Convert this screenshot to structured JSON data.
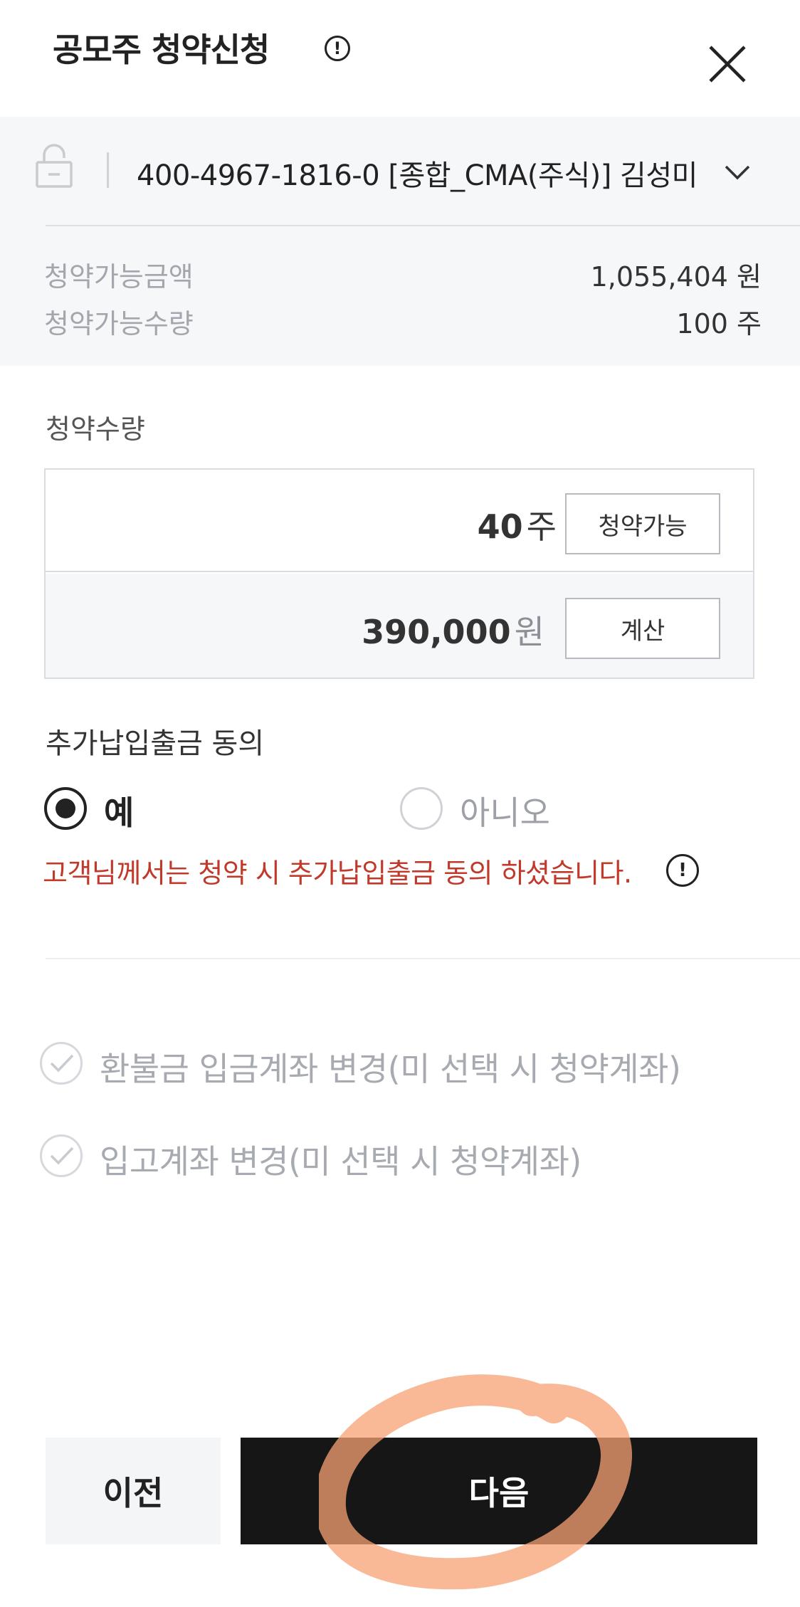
{
  "header": {
    "title": "공모주 청약신청",
    "info_glyph": "!",
    "icons": {
      "info": "info-circle-icon",
      "close": "close-icon"
    }
  },
  "account": {
    "number": "400-4967-1816-0  [종합_CMA(주식)] 김성미",
    "icons": {
      "lock": "lock-icon",
      "chevron": "chevron-down-icon"
    },
    "available_amount_label": "청약가능금액",
    "available_amount_value": "1,055,404 원",
    "available_qty_label": "청약가능수량",
    "available_qty_value": "100 주"
  },
  "quantity": {
    "label": "청약수량",
    "value": "40",
    "unit": "주",
    "max_button": "청약가능",
    "amount": "390,000",
    "amount_unit": "원",
    "calc_button": "계산"
  },
  "consent": {
    "label": "추가납입출금 동의",
    "yes": "예",
    "no": "아니오",
    "selected": "yes",
    "notice": "고객님께서는 청약 시 추가납입출금 동의 하셨습니다.",
    "notice_glyph": "!"
  },
  "options": {
    "refund_account": "환불금 입금계좌 변경(미 선택 시 청약계좌)",
    "deposit_account": "입고계좌 변경(미 선택 시 청약계좌)"
  },
  "footer": {
    "prev": "이전",
    "next": "다음"
  },
  "colors": {
    "primary_button": "#161616",
    "notice_text": "#c0392b",
    "annotation": "#f7a274"
  }
}
